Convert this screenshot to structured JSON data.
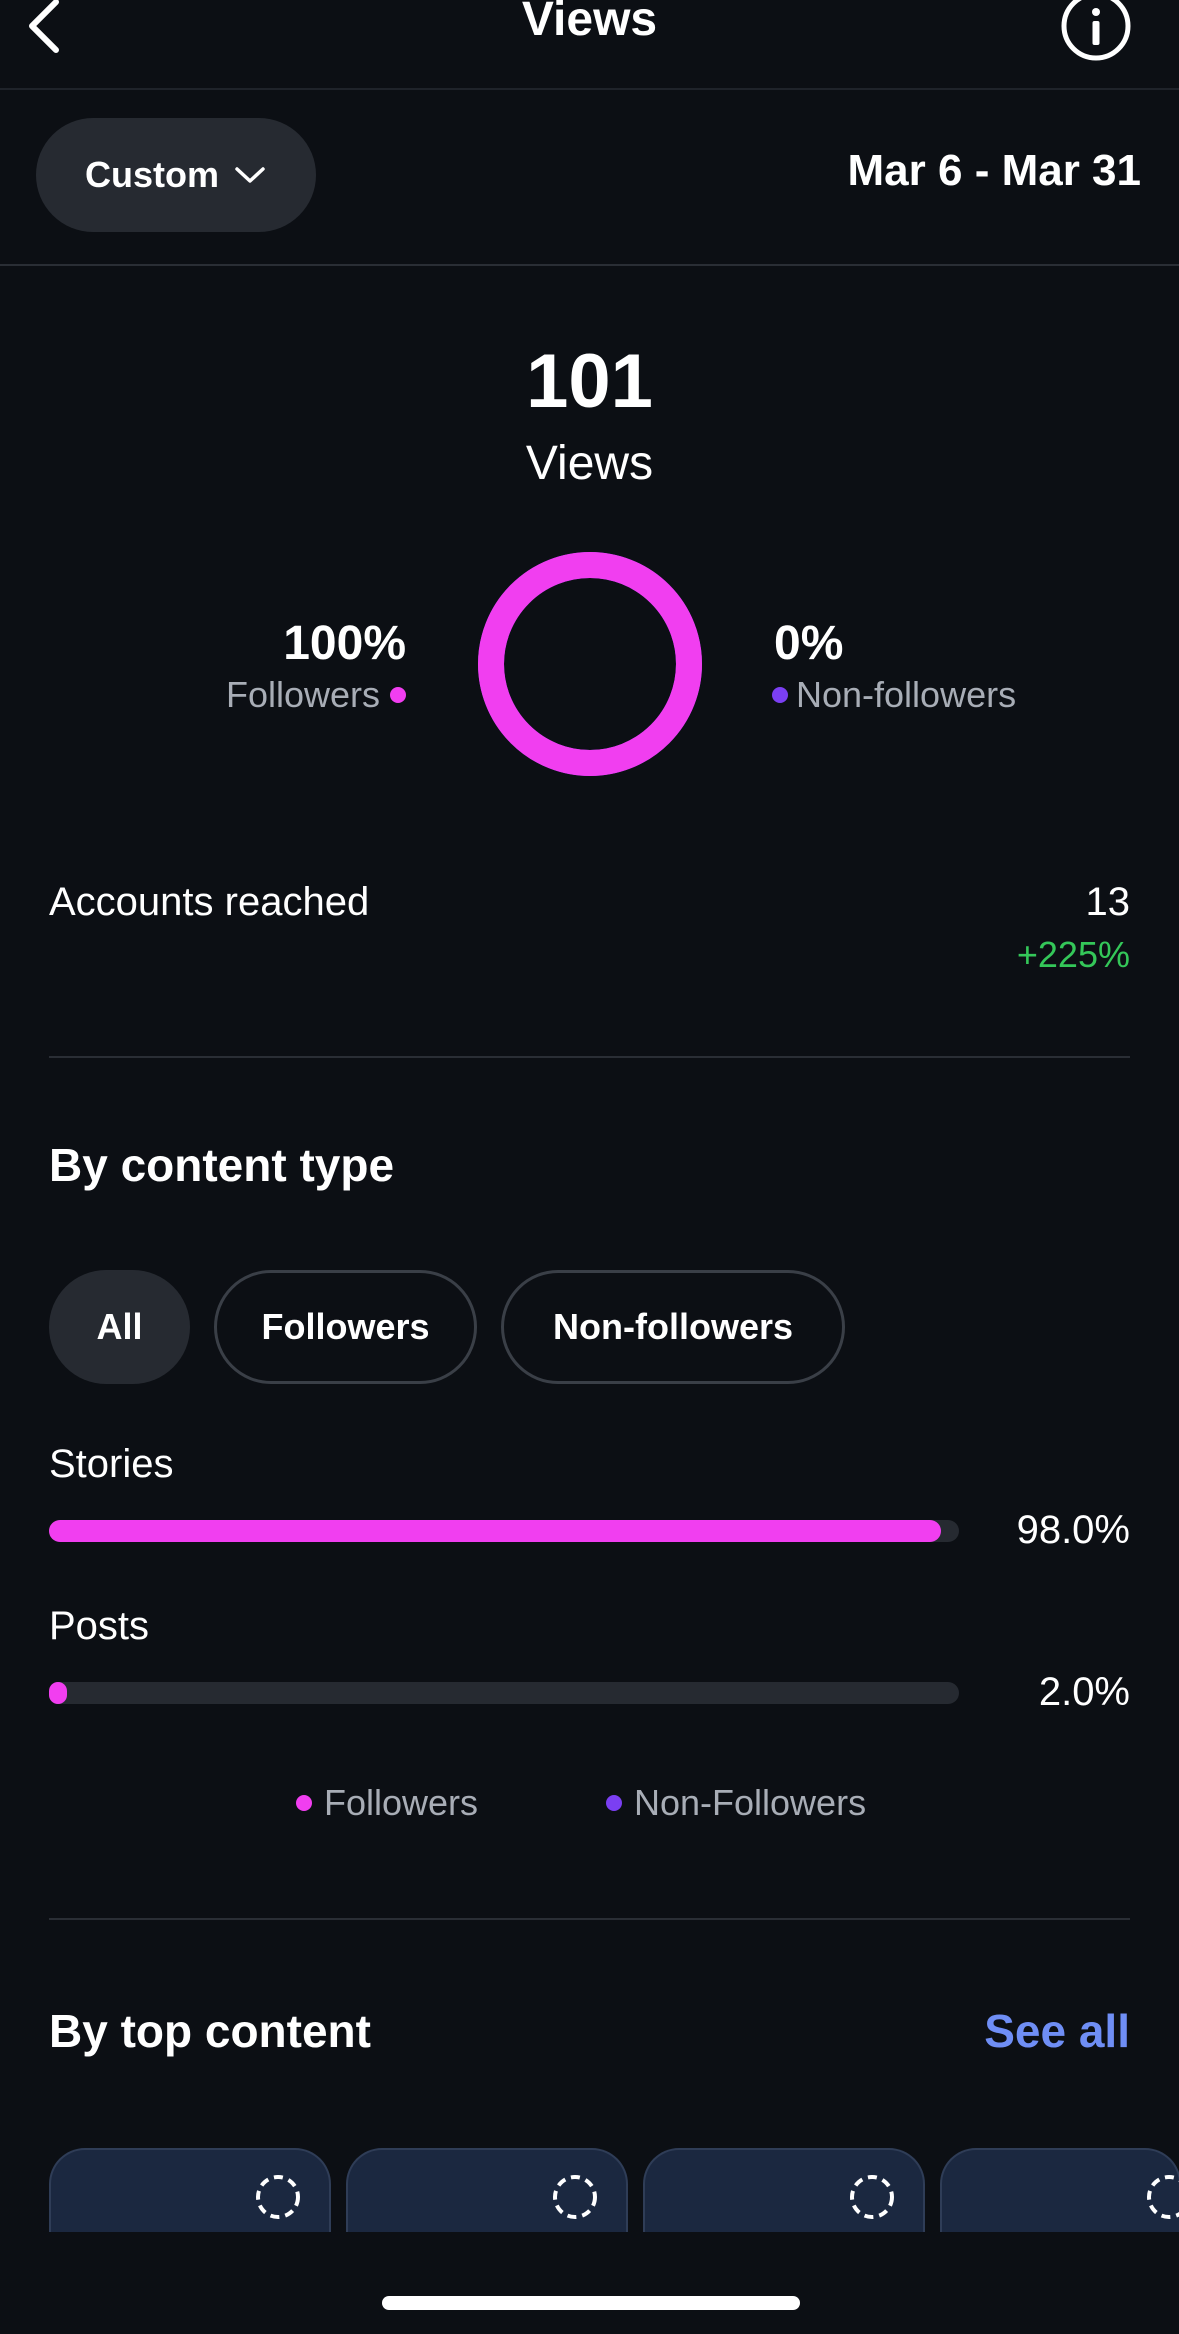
{
  "header": {
    "title": "Views"
  },
  "filter": {
    "label": "Custom",
    "date_range": "Mar 6 - Mar 31"
  },
  "summary": {
    "total": "101",
    "total_label": "Views",
    "followers_pct": "100%",
    "followers_label": "Followers",
    "nonfollowers_pct": "0%",
    "nonfollowers_label": "Non-followers",
    "followers_share": 1.0
  },
  "accounts": {
    "label": "Accounts reached",
    "value": "13",
    "change": "+225%"
  },
  "content_type": {
    "title": "By content type",
    "chips": [
      "All",
      "Followers",
      "Non-followers"
    ],
    "selected_chip": "All",
    "bars": [
      {
        "label": "Stories",
        "pct": "98.0%",
        "value": 98.0
      },
      {
        "label": "Posts",
        "pct": "2.0%",
        "value": 2.0
      }
    ],
    "legend": [
      "Followers",
      "Non-Followers"
    ]
  },
  "top_content": {
    "title": "By top content",
    "see_all": "See all"
  },
  "colors": {
    "followers": "#f13ef0",
    "nonfollowers": "#7b3ff2",
    "accent_link": "#6f8ef5",
    "positive": "#34c759"
  },
  "icons": [
    "back-arrow-icon",
    "info-icon",
    "chevron-down-icon",
    "loading-spinner-icon"
  ]
}
